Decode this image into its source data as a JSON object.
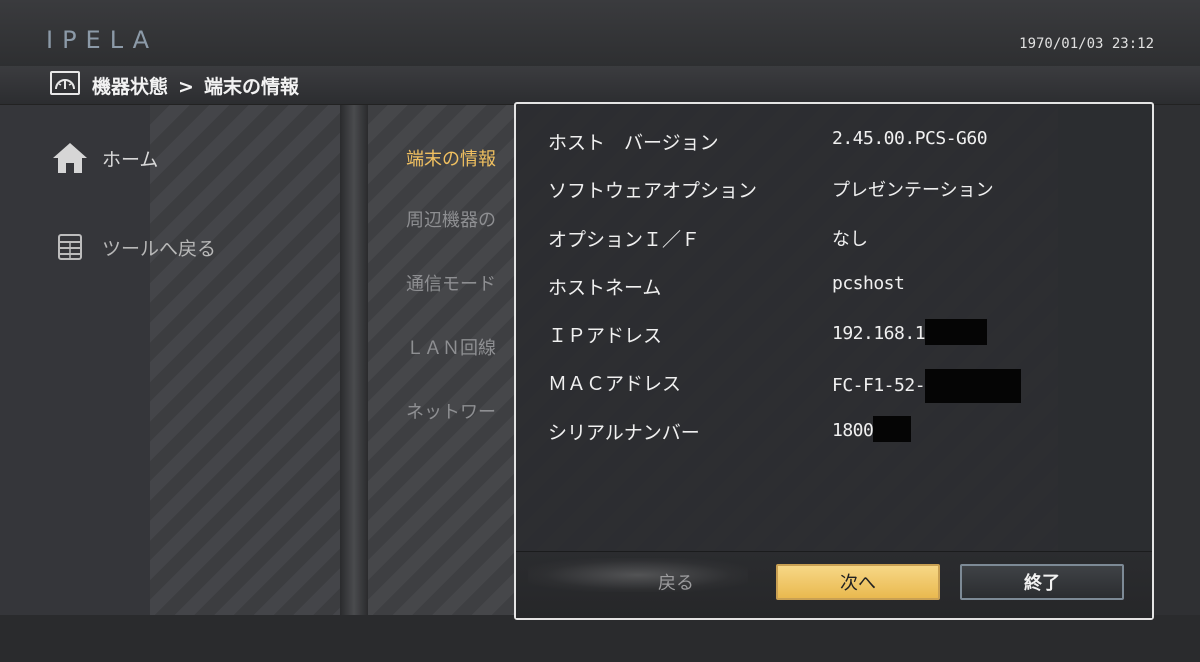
{
  "header": {
    "logo": "IPELA",
    "datetime": "1970/01/03 23:12"
  },
  "breadcrumb": {
    "icon": "meter-icon",
    "parent": "機器状態",
    "separator": ">",
    "current": "端末の情報"
  },
  "sidebar": {
    "items": [
      {
        "label": "ホーム",
        "icon": "home-icon"
      },
      {
        "label": "ツールへ戻る",
        "icon": "toolbox-icon"
      }
    ]
  },
  "menu": {
    "items": [
      {
        "label": "端末の情報",
        "active": true
      },
      {
        "label": "周辺機器の",
        "active": false
      },
      {
        "label": "通信モード",
        "active": false
      },
      {
        "label": "ＬＡＮ回線",
        "active": false
      },
      {
        "label": "ネットワー",
        "active": false
      }
    ]
  },
  "dialog": {
    "rows": [
      {
        "label": "ホスト　バージョン",
        "value": "2.45.00.PCS-G60"
      },
      {
        "label": "ソフトウェアオプション",
        "value": "プレゼンテーション"
      },
      {
        "label": "オプションＩ／Ｆ",
        "value": "なし"
      },
      {
        "label": "ホストネーム",
        "value": "pcshost"
      },
      {
        "label": "ＩＰアドレス",
        "value": "192.168.1"
      },
      {
        "label": "ＭＡＣアドレス",
        "value": "FC-F1-52-"
      },
      {
        "label": "シリアルナンバー",
        "value": "1800"
      }
    ],
    "buttons": {
      "back": "戻る",
      "next": "次へ",
      "end": "終了"
    }
  },
  "colors": {
    "active_menu": "#f0c060",
    "next_button": "#f0c864",
    "end_button_border": "#7d8a96"
  }
}
